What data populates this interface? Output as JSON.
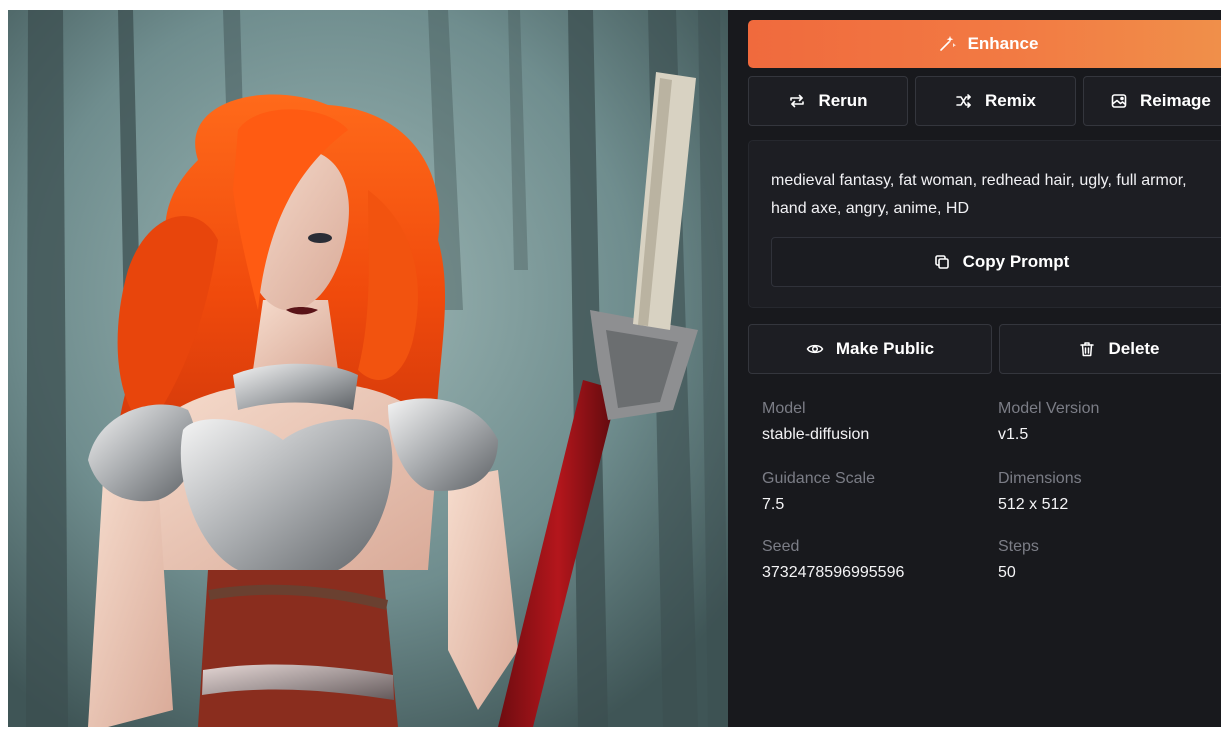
{
  "actions": {
    "enhance": {
      "label": "Enhance",
      "icon": "magic-wand-icon"
    },
    "rerun": {
      "label": "Rerun",
      "icon": "repeat-icon"
    },
    "remix": {
      "label": "Remix",
      "icon": "shuffle-icon"
    },
    "reimage": {
      "label": "Reimage",
      "icon": "image-icon"
    },
    "copy_prompt": {
      "label": "Copy Prompt",
      "icon": "copy-icon"
    },
    "make_public": {
      "label": "Make Public",
      "icon": "eye-icon"
    },
    "delete": {
      "label": "Delete",
      "icon": "trash-icon"
    }
  },
  "prompt": {
    "text": "medieval fantasy, fat woman, redhead hair, ugly, full armor, hand axe, angry, anime, HD"
  },
  "details": {
    "model": {
      "label": "Model",
      "value": "stable-diffusion"
    },
    "model_version": {
      "label": "Model Version",
      "value": "v1.5"
    },
    "guidance_scale": {
      "label": "Guidance Scale",
      "value": "7.5"
    },
    "dimensions": {
      "label": "Dimensions",
      "value": "512 x 512"
    },
    "seed": {
      "label": "Seed",
      "value": "3732478596995596"
    },
    "steps": {
      "label": "Steps",
      "value": "50"
    }
  },
  "colors": {
    "accent_start": "#f06a3d",
    "accent_end": "#f0904a",
    "panel_bg": "#18191d",
    "button_bg": "#1d1e23",
    "muted_text": "#7b7d86"
  }
}
